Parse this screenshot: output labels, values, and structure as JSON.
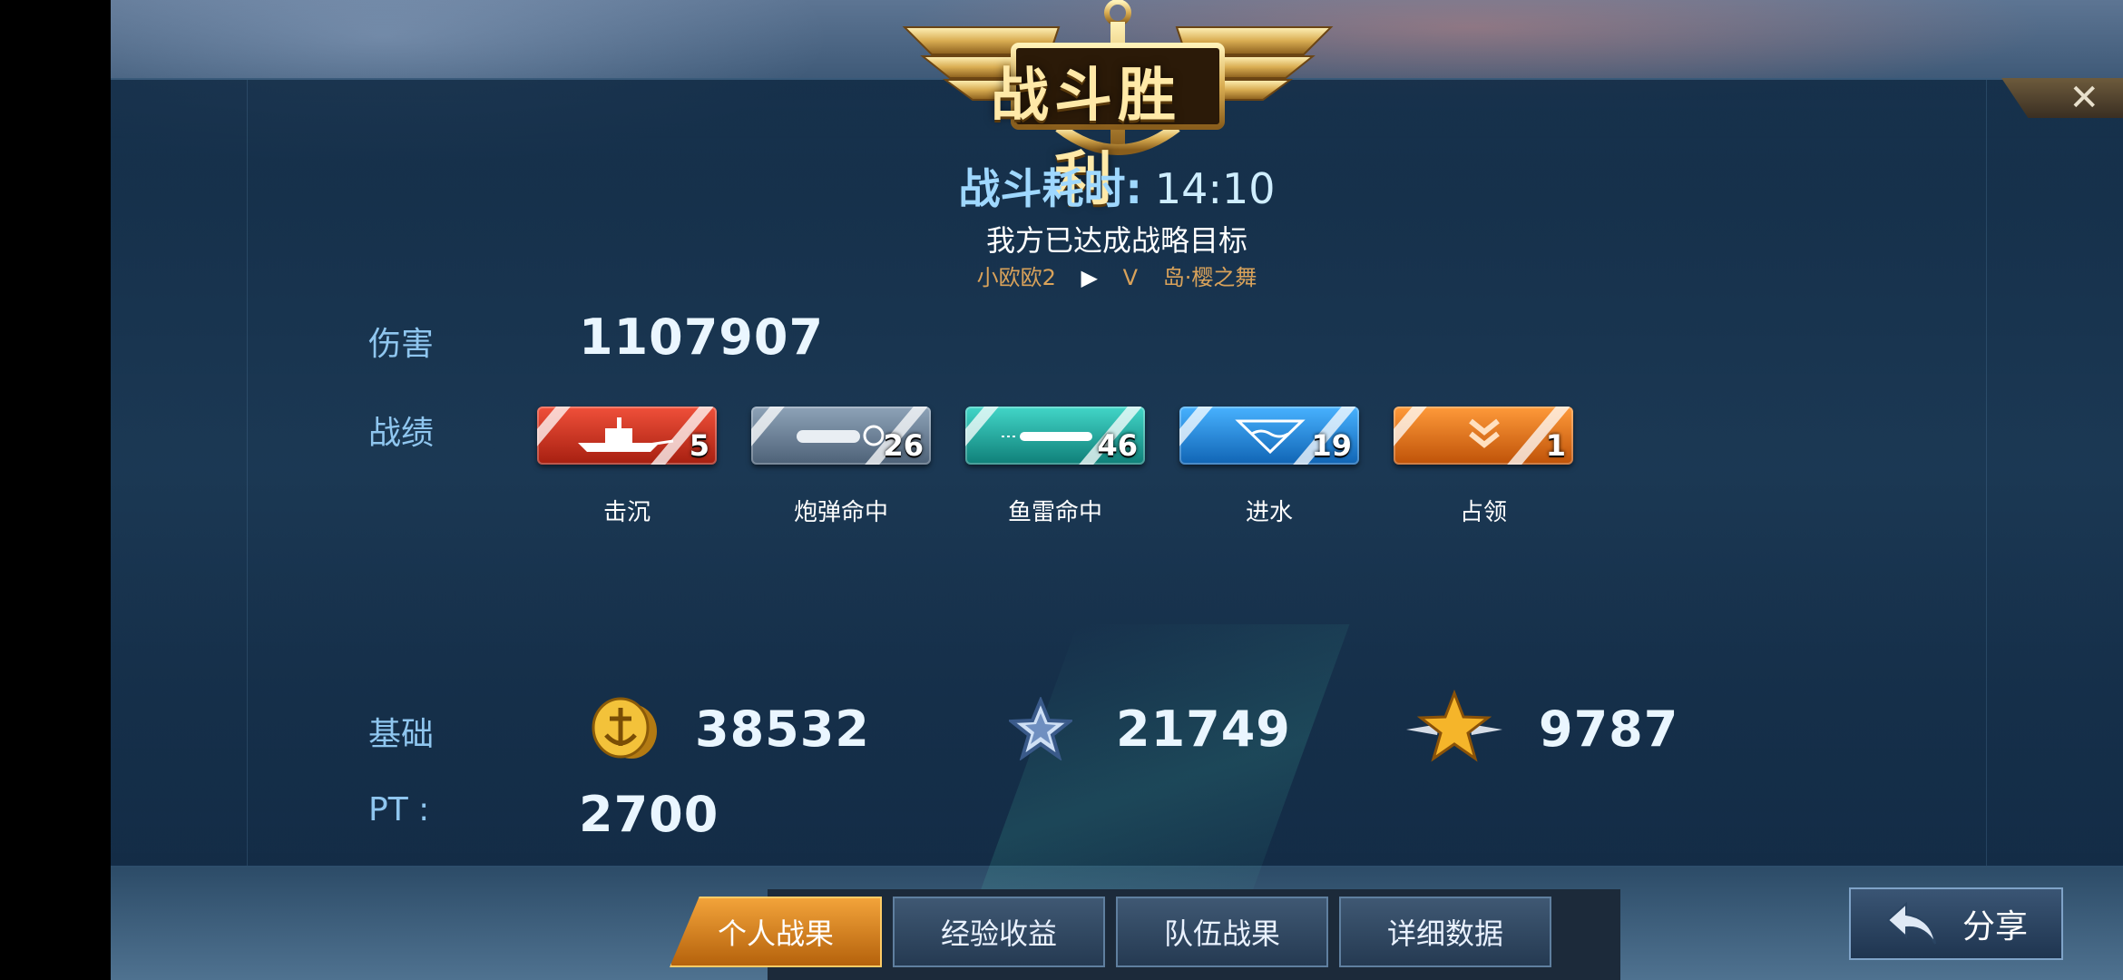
{
  "header": {
    "title": "战斗胜利",
    "close_label": "✕",
    "duration_label": "战斗耗时:",
    "duration_value": "14:10",
    "objective": "我方已达成战略目标",
    "player_name": "小欧欧2",
    "arrow": "▶",
    "rank": "V",
    "map_name": "岛·樱之舞"
  },
  "damage": {
    "label": "伤害",
    "value": "1107907"
  },
  "record": {
    "label": "战绩",
    "items": [
      {
        "name": "击沉",
        "count": "5",
        "color": "#d8321c",
        "icon": "sinking-ship-icon"
      },
      {
        "name": "炮弹命中",
        "count": "26",
        "color": "#6a7f95",
        "icon": "shell-hit-icon"
      },
      {
        "name": "鱼雷命中",
        "count": "46",
        "color": "#1aa8a0",
        "icon": "torpedo-icon"
      },
      {
        "name": "进水",
        "count": "19",
        "color": "#1f8fd8",
        "icon": "flooding-icon"
      },
      {
        "name": "占领",
        "count": "1",
        "color": "#e36c14",
        "icon": "capture-chevron-icon"
      }
    ]
  },
  "base": {
    "label": "基础",
    "coins": {
      "value": "38532",
      "icon": "gold-coin-icon"
    },
    "silver_star": {
      "value": "21749",
      "icon": "silver-star-icon"
    },
    "gold_star": {
      "value": "9787",
      "icon": "gold-winged-star-icon"
    }
  },
  "pt": {
    "label": "PT :",
    "value": "2700"
  },
  "tabs": [
    {
      "label": "个人战果",
      "active": true
    },
    {
      "label": "经验收益",
      "active": false
    },
    {
      "label": "队伍战果",
      "active": false
    },
    {
      "label": "详细数据",
      "active": false
    }
  ],
  "share": {
    "label": "分享",
    "icon": "share-arrow-icon"
  }
}
